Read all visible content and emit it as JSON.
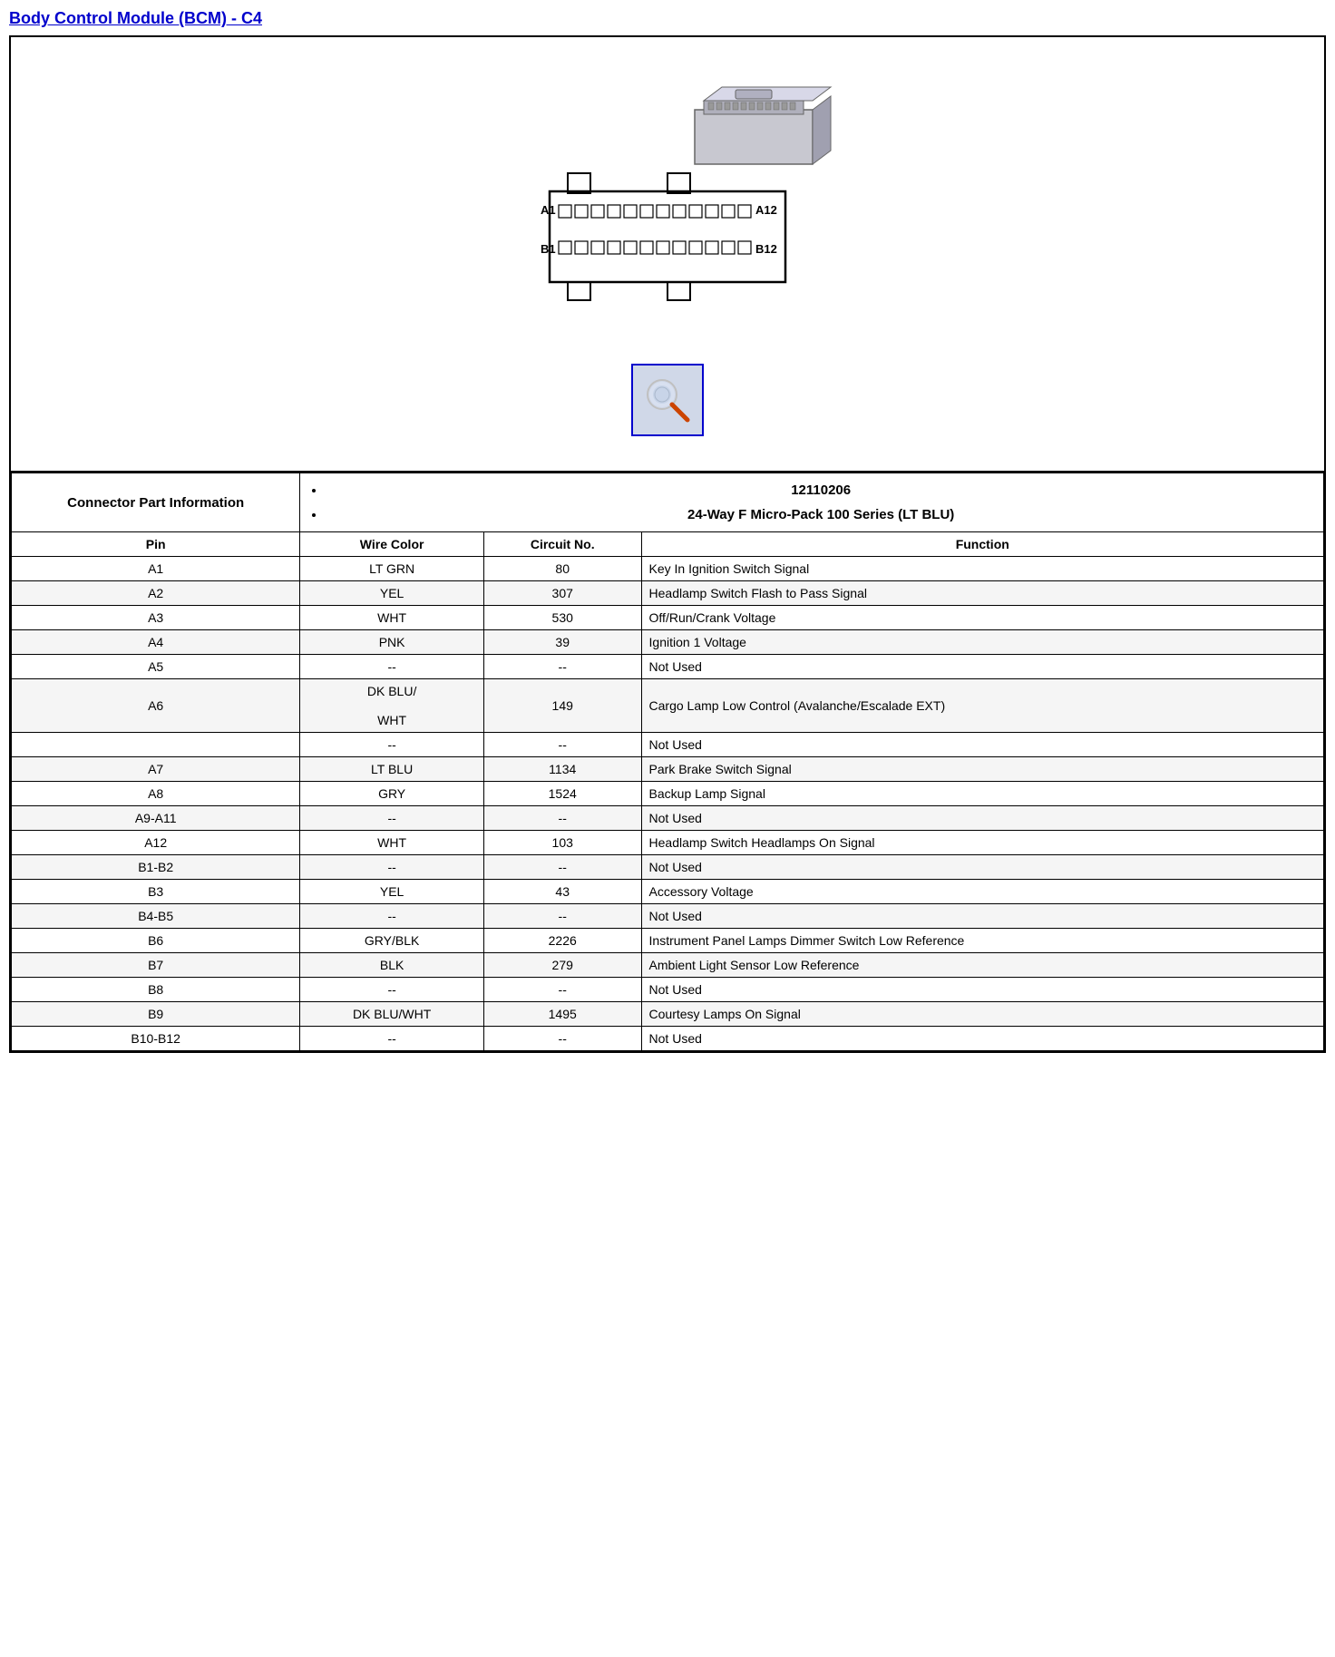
{
  "title": "Body Control Module (BCM) - C4",
  "connector_part_label": "Connector Part Information",
  "connector_parts": [
    "12110206",
    "24-Way F Micro-Pack 100 Series (LT BLU)"
  ],
  "table_headers": [
    "Pin",
    "Wire Color",
    "Circuit No.",
    "Function"
  ],
  "rows": [
    {
      "pin": "A1",
      "wire": "LT GRN",
      "circuit": "80",
      "function": "Key In Ignition Switch Signal"
    },
    {
      "pin": "A2",
      "wire": "YEL",
      "circuit": "307",
      "function": "Headlamp Switch Flash to Pass Signal"
    },
    {
      "pin": "A3",
      "wire": "WHT",
      "circuit": "530",
      "function": "Off/Run/Crank Voltage"
    },
    {
      "pin": "A4",
      "wire": "PNK",
      "circuit": "39",
      "function": "Ignition 1 Voltage"
    },
    {
      "pin": "A5",
      "wire": "--",
      "circuit": "--",
      "function": "Not Used"
    },
    {
      "pin": "A6",
      "wire": "DK BLU/\n\nWHT",
      "circuit": "149",
      "function": "Cargo Lamp Low Control (Avalanche/Escalade EXT)"
    },
    {
      "pin": "",
      "wire": "--",
      "circuit": "--",
      "function": "Not Used"
    },
    {
      "pin": "A7",
      "wire": "LT BLU",
      "circuit": "1134",
      "function": "Park Brake Switch Signal"
    },
    {
      "pin": "A8",
      "wire": "GRY",
      "circuit": "1524",
      "function": "Backup Lamp Signal"
    },
    {
      "pin": "A9-A11",
      "wire": "--",
      "circuit": "--",
      "function": "Not Used"
    },
    {
      "pin": "A12",
      "wire": "WHT",
      "circuit": "103",
      "function": "Headlamp Switch Headlamps On Signal"
    },
    {
      "pin": "B1-B2",
      "wire": "--",
      "circuit": "--",
      "function": "Not Used"
    },
    {
      "pin": "B3",
      "wire": "YEL",
      "circuit": "43",
      "function": "Accessory Voltage"
    },
    {
      "pin": "B4-B5",
      "wire": "--",
      "circuit": "--",
      "function": "Not Used"
    },
    {
      "pin": "B6",
      "wire": "GRY/BLK",
      "circuit": "2226",
      "function": "Instrument Panel Lamps Dimmer Switch Low Reference"
    },
    {
      "pin": "B7",
      "wire": "BLK",
      "circuit": "279",
      "function": "Ambient Light Sensor Low Reference"
    },
    {
      "pin": "B8",
      "wire": "--",
      "circuit": "--",
      "function": "Not Used"
    },
    {
      "pin": "B9",
      "wire": "DK BLU/WHT",
      "circuit": "1495",
      "function": "Courtesy Lamps On Signal"
    },
    {
      "pin": "B10-B12",
      "wire": "--",
      "circuit": "--",
      "function": "Not Used"
    }
  ]
}
